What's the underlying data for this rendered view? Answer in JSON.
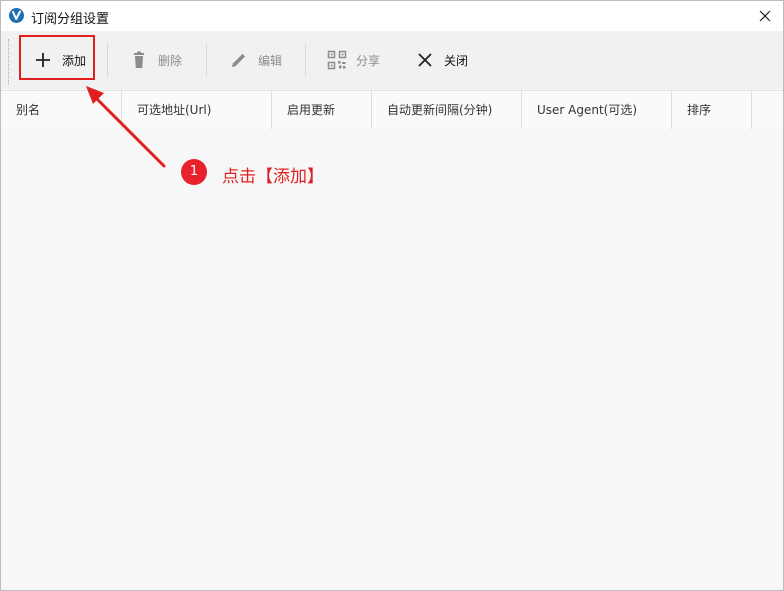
{
  "window": {
    "title": "订阅分组设置"
  },
  "toolbar": {
    "add_label": "添加",
    "delete_label": "删除",
    "edit_label": "编辑",
    "share_label": "分享",
    "close_label": "关闭"
  },
  "table": {
    "columns": [
      "别名",
      "可选地址(Url)",
      "启用更新",
      "自动更新间隔(分钟)",
      "User Agent(可选)",
      "排序"
    ],
    "rows": []
  },
  "annotation": {
    "step": "1",
    "text": "点击【添加】"
  },
  "colors": {
    "accent": "#e02020",
    "app_icon": "#1f6fb2",
    "disabled_text": "#8c8c8c"
  }
}
